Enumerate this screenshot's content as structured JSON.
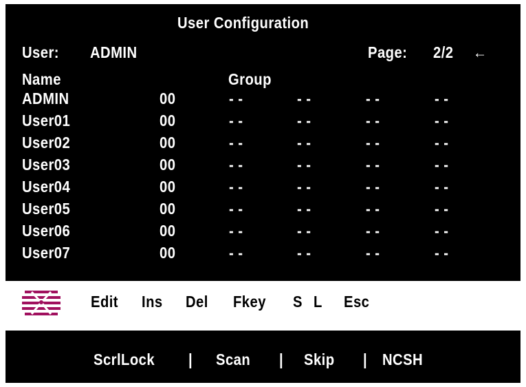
{
  "title": "User Configuration",
  "user_label": "User:",
  "user_value": "ADMIN",
  "page_label": "Page:",
  "page_value": "2/2",
  "page_arrow": "←",
  "headers": {
    "name": "Name",
    "group": "Group"
  },
  "rows": [
    {
      "name": "ADMIN",
      "code": "00",
      "groups": [
        "- -",
        "- -",
        "- -",
        "- -"
      ]
    },
    {
      "name": "User01",
      "code": "00",
      "groups": [
        "- -",
        "- -",
        "- -",
        "- -"
      ]
    },
    {
      "name": "User02",
      "code": "00",
      "groups": [
        "- -",
        "- -",
        "- -",
        "- -"
      ]
    },
    {
      "name": "User03",
      "code": "00",
      "groups": [
        "- -",
        "- -",
        "- -",
        "- -"
      ]
    },
    {
      "name": "User04",
      "code": "00",
      "groups": [
        "- -",
        "- -",
        "- -",
        "- -"
      ]
    },
    {
      "name": "User05",
      "code": "00",
      "groups": [
        "- -",
        "- -",
        "- -",
        "- -"
      ]
    },
    {
      "name": "User06",
      "code": "00",
      "groups": [
        "- -",
        "- -",
        "- -",
        "- -"
      ]
    },
    {
      "name": "User07",
      "code": "00",
      "groups": [
        "- -",
        "- -",
        "- -",
        "- -"
      ]
    }
  ],
  "commands": [
    "Edit",
    "Ins",
    "Del",
    "Fkey",
    "S",
    "L",
    "Esc"
  ],
  "status": [
    "ScrlLock",
    "|",
    "Scan",
    "|",
    "Skip",
    "|",
    "NCSH"
  ],
  "logo_color": "#a0105e"
}
